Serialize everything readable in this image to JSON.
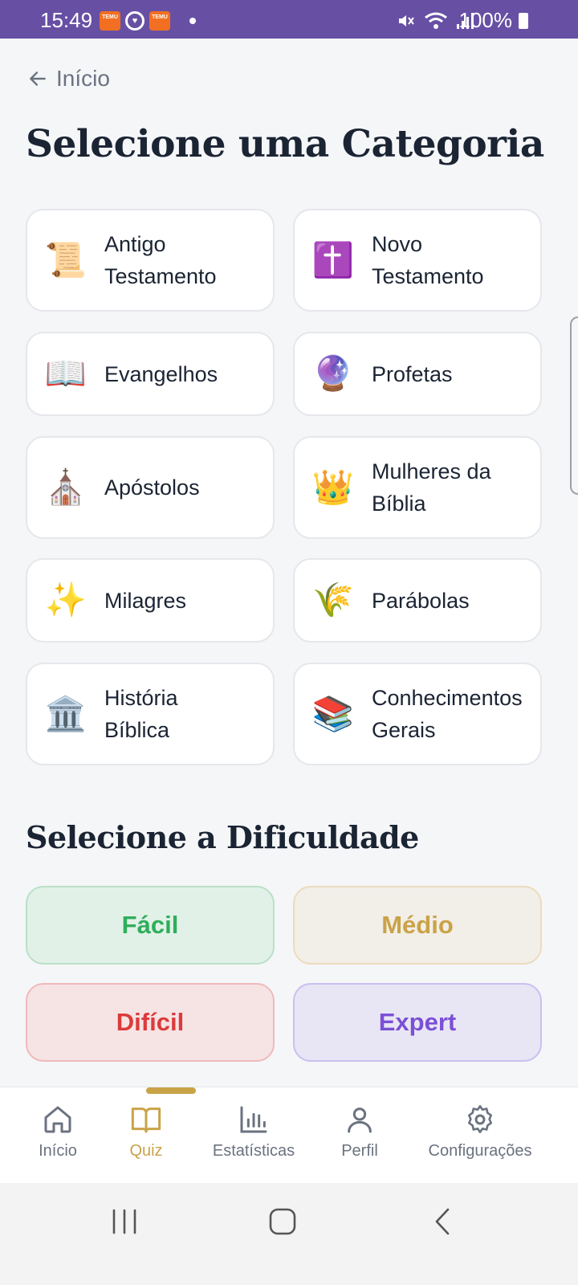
{
  "status_bar": {
    "time": "15:49",
    "battery": "100%",
    "temu_label": "TEMU",
    "icons": [
      "temu-icon",
      "heart-ring-icon",
      "temu-icon",
      "dot-icon",
      "mute-icon",
      "wifi-icon",
      "signal-icon",
      "battery-icon"
    ]
  },
  "header": {
    "back_label": "Início",
    "title": "Selecione uma Categoria"
  },
  "categories": [
    {
      "emoji": "📜",
      "icon": "scroll-icon",
      "label_1": "Antigo",
      "label_2": "Testamento"
    },
    {
      "emoji": "✝️",
      "icon": "cross-icon",
      "label_1": "Novo",
      "label_2": "Testamento"
    },
    {
      "emoji": "📖",
      "icon": "open-book-icon",
      "label_1": "Evangelhos",
      "label_2": ""
    },
    {
      "emoji": "🔮",
      "icon": "crystal-ball-icon",
      "label_1": "Profetas",
      "label_2": ""
    },
    {
      "emoji": "⛪",
      "icon": "church-icon",
      "label_1": "Apóstolos",
      "label_2": ""
    },
    {
      "emoji": "👑",
      "icon": "crown-icon",
      "label_1": "Mulheres da",
      "label_2": "Bíblia"
    },
    {
      "emoji": "✨",
      "icon": "sparkles-icon",
      "label_1": "Milagres",
      "label_2": ""
    },
    {
      "emoji": "🌾",
      "icon": "wheat-icon",
      "label_1": "Parábolas",
      "label_2": ""
    },
    {
      "emoji": "🏛️",
      "icon": "classical-building-icon",
      "label_1": "História",
      "label_2": "Bíblica"
    },
    {
      "emoji": "📚",
      "icon": "books-icon",
      "label_1": "Conhecimentos",
      "label_2": "Gerais"
    }
  ],
  "difficulty": {
    "title": "Selecione a Dificuldade",
    "levels": [
      {
        "label": "Fácil",
        "text_color": "#2fae5b",
        "bg": "#e2f1e8",
        "border": "#b9e0c8"
      },
      {
        "label": "Médio",
        "text_color": "#c9a347",
        "bg": "#f2eee8",
        "border": "#ecdcbd"
      },
      {
        "label": "Difícil",
        "text_color": "#dc3b3b",
        "bg": "#f6e3e4",
        "border": "#f0b9bc"
      },
      {
        "label": "Expert",
        "text_color": "#7b4fd6",
        "bg": "#e8e6f5",
        "border": "#cbbff0"
      }
    ]
  },
  "bottom_nav": {
    "active_color": "#c9a347",
    "items": [
      {
        "label": "Início",
        "icon": "home-icon"
      },
      {
        "label": "Quiz",
        "icon": "book-icon"
      },
      {
        "label": "Estatísticas",
        "icon": "bar-chart-icon"
      },
      {
        "label": "Perfil",
        "icon": "user-icon"
      },
      {
        "label": "Configurações",
        "icon": "gear-icon"
      }
    ]
  },
  "system_nav": [
    "recents-icon",
    "home-button-icon",
    "back-chevron-icon"
  ]
}
